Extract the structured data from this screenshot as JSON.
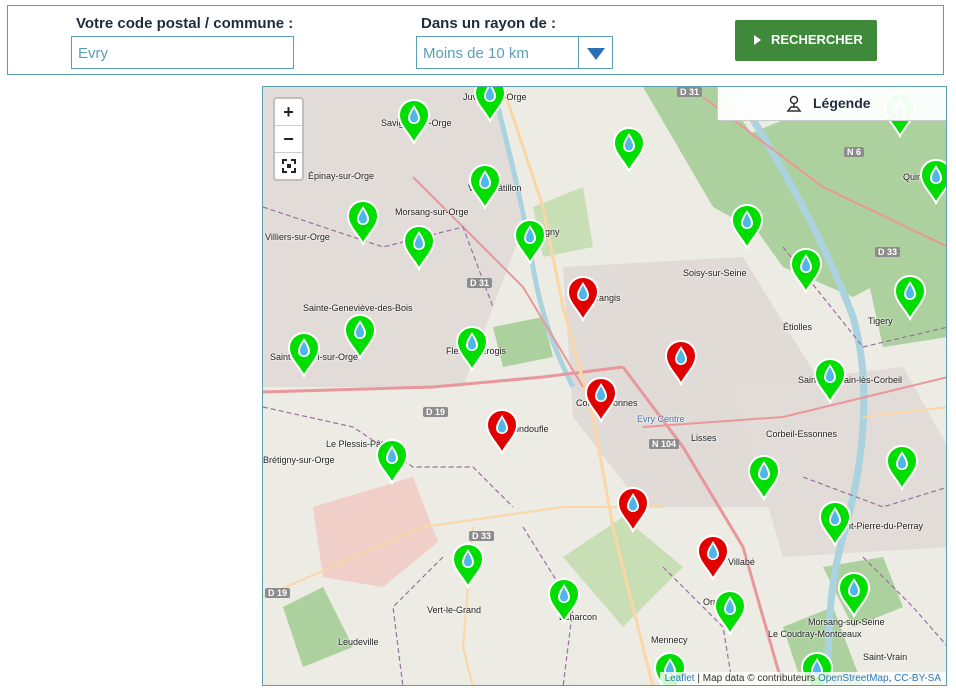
{
  "form": {
    "postal_label": "Votre code postal / commune :",
    "postal_value": "Evry",
    "radius_label": "Dans un rayon de :",
    "radius_value": "Moins de 10 km",
    "search_label": "RECHERCHER"
  },
  "map": {
    "zoom_in": "+",
    "zoom_out": "−",
    "legend_label": "Légende",
    "attribution": {
      "leaflet": "Leaflet",
      "sep": " | Map data © contributeurs ",
      "osm": "OpenStreetMap",
      "comma": ", ",
      "license": "CC-BY-SA"
    },
    "towns": [
      "Juvisy-sur-Orge",
      "Savigny-sur-Orge",
      "Épinay-sur-Orge",
      "Viry-Châtillon",
      "Morsang-sur-Orge",
      "Villiers-sur-Orge",
      "Grigny",
      "Ris-Orangis",
      "Soisy-sur-Seine",
      "Étiolles",
      "Tigery",
      "Sainte-Geneviève-des-Bois",
      "Saint-Michel-sur-Orge",
      "Fleury-Mérogis",
      "Courcouronnes",
      "Bondoufle",
      "Saint-Germain-lès-Corbeil",
      "Corbeil-Essonnes",
      "Le Plessis-Pâté",
      "Brétigny-sur-Orge",
      "Lisses",
      "Villabé",
      "Saint-Pierre-du-Perray",
      "Vert-le-Grand",
      "Écharcon",
      "Mennecy",
      "Ormoy",
      "Morsang-sur-Seine",
      "Le Coudray-Montceaux",
      "Leudeville",
      "Saint-Vrain",
      "Quincy-sous-Sénart",
      "Evry Centre"
    ],
    "roads": [
      "D 31",
      "D 33",
      "D 19",
      "N 104",
      "N 6",
      "D 31",
      "D 33",
      "D 19"
    ],
    "station_status_colors": {
      "conforme": "#00dd00",
      "non_conforme": "#e00000"
    },
    "station_icon": "water-drop-icon"
  }
}
